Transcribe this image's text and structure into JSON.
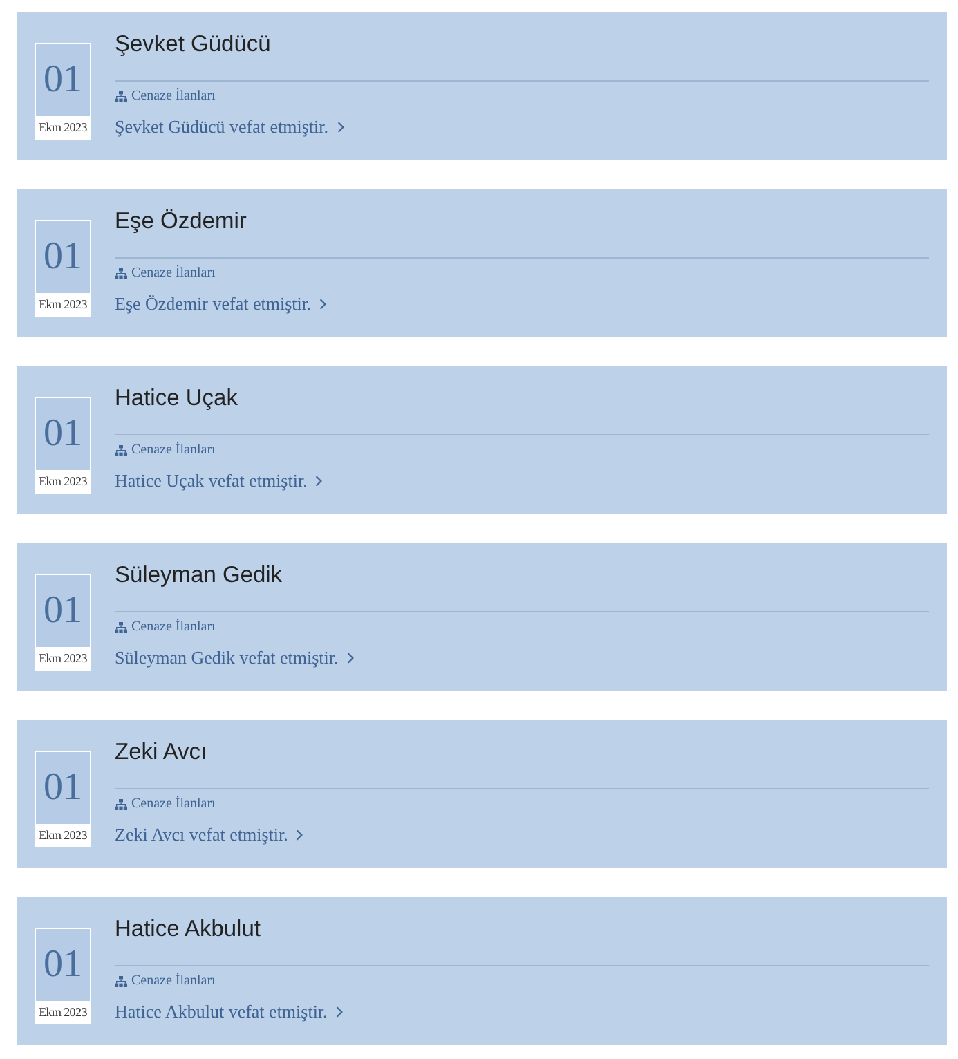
{
  "posts": [
    {
      "day": "01",
      "month_year": "Ekm 2023",
      "title": "Şevket Güdücü",
      "category": "Cenaze İlanları",
      "summary": "Şevket Güdücü vefat etmiştir."
    },
    {
      "day": "01",
      "month_year": "Ekm 2023",
      "title": "Eşe Özdemir",
      "category": "Cenaze İlanları",
      "summary": "Eşe Özdemir vefat etmiştir."
    },
    {
      "day": "01",
      "month_year": "Ekm 2023",
      "title": "Hatice Uçak",
      "category": "Cenaze İlanları",
      "summary": "Hatice Uçak vefat etmiştir."
    },
    {
      "day": "01",
      "month_year": "Ekm 2023",
      "title": "Süleyman Gedik",
      "category": "Cenaze İlanları",
      "summary": "Süleyman Gedik vefat etmiştir."
    },
    {
      "day": "01",
      "month_year": "Ekm 2023",
      "title": "Zeki Avcı",
      "category": "Cenaze İlanları",
      "summary": "Zeki Avcı vefat etmiştir."
    },
    {
      "day": "01",
      "month_year": "Ekm 2023",
      "title": "Hatice Akbulut",
      "category": "Cenaze İlanları",
      "summary": "Hatice Akbulut vefat etmiştir."
    }
  ]
}
